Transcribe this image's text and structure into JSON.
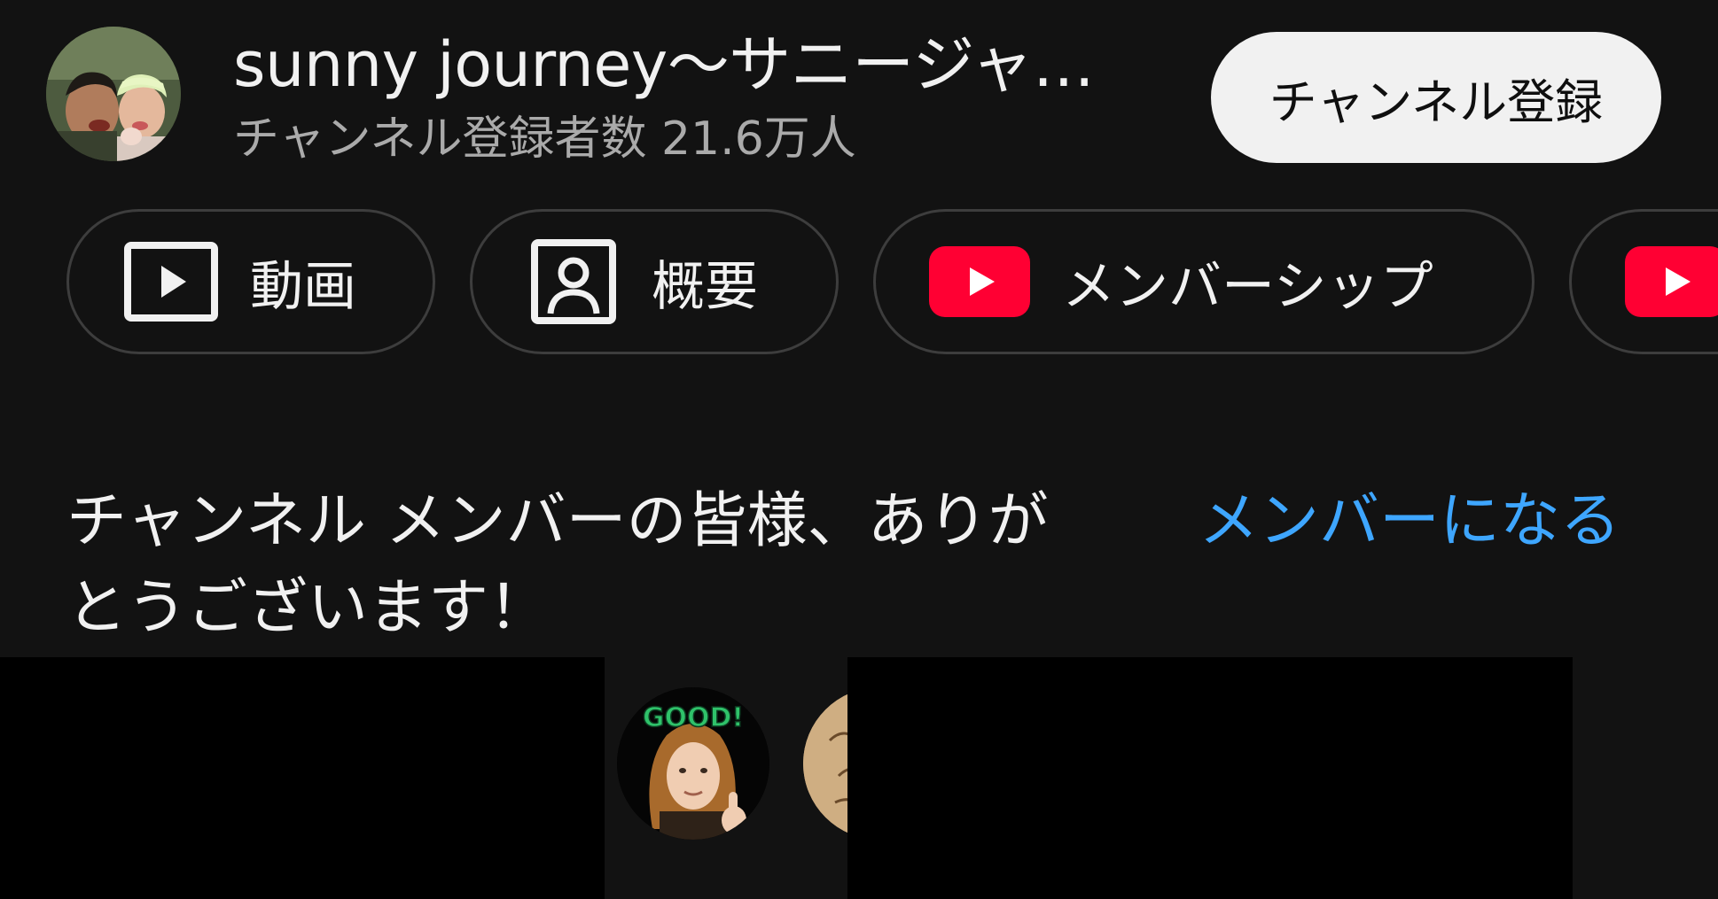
{
  "channel": {
    "title": "sunny journey〜サニージャ…",
    "subscriber_count": "チャンネル登録者数 21.6万人",
    "subscribe_label": "チャンネル登録"
  },
  "chips": {
    "videos_label": "動画",
    "about_label": "概要",
    "membership_label": "メンバーシップ"
  },
  "members": {
    "thanks_text": "チャンネル メンバーの皆様、ありがとうございます！",
    "join_label": "メンバーになる",
    "avatar_badge_text": "GOOD!"
  },
  "colors": {
    "background": "#121212",
    "link": "#3ea6ff",
    "youtube_red": "#ff0033",
    "chip_border": "#3d3d3d",
    "secondary_text": "#aaaaaa"
  },
  "icons": {
    "videos": "play-box-icon",
    "about": "person-box-icon",
    "membership": "youtube-logo-icon"
  }
}
